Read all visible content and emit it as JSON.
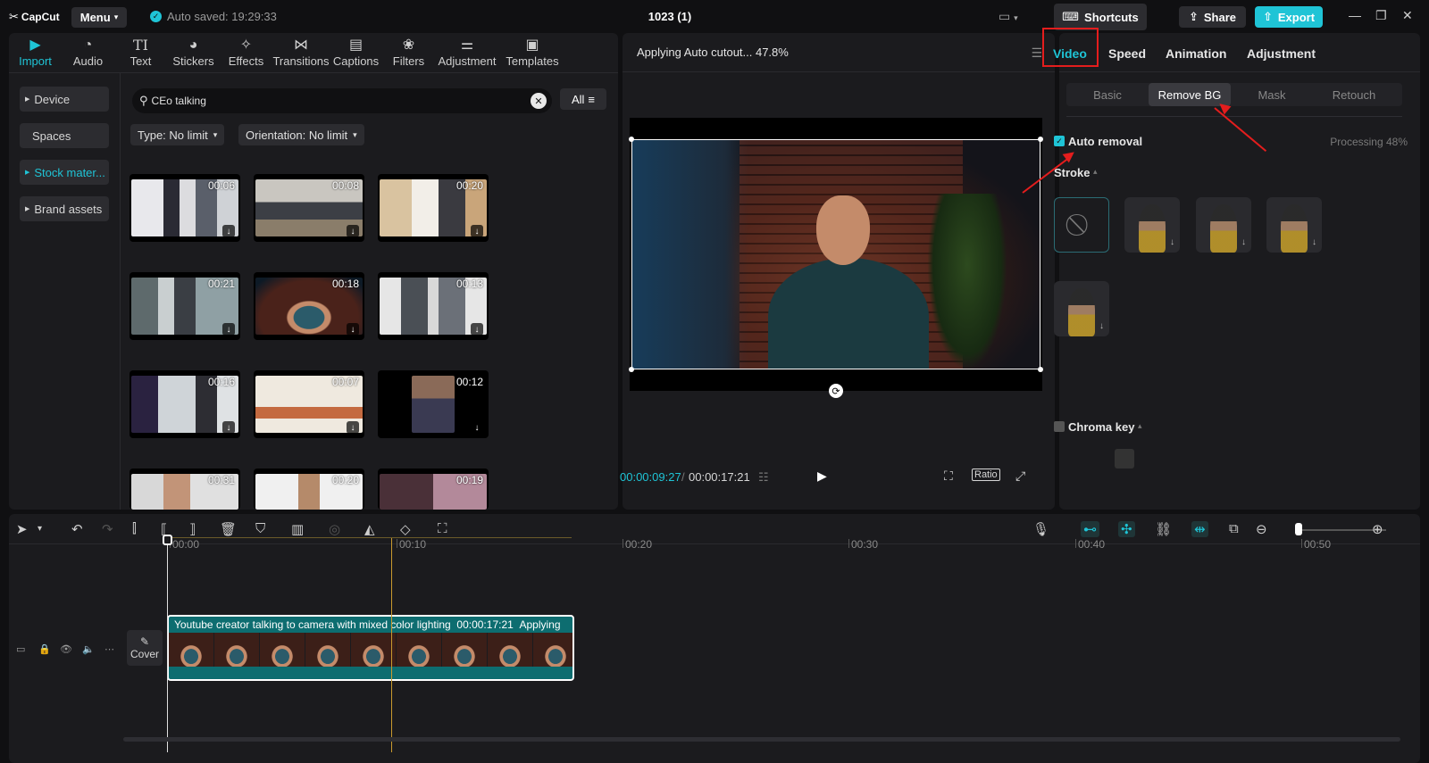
{
  "app": {
    "logo_text": "CapCut",
    "menu_label": "Menu",
    "autosave_text": "Auto saved: 19:29:33",
    "project_title": "1023 (1)",
    "shortcuts_label": "Shortcuts",
    "share_label": "Share",
    "export_label": "Export",
    "accent_color": "#1fc4d6"
  },
  "media": {
    "tabs": [
      {
        "label": "Import",
        "icon": "import-icon"
      },
      {
        "label": "Audio",
        "icon": "audio-icon"
      },
      {
        "label": "Text",
        "icon": "text-icon"
      },
      {
        "label": "Stickers",
        "icon": "stickers-icon"
      },
      {
        "label": "Effects",
        "icon": "effects-icon"
      },
      {
        "label": "Transitions",
        "icon": "transitions-icon"
      },
      {
        "label": "Captions",
        "icon": "captions-icon"
      },
      {
        "label": "Filters",
        "icon": "filters-icon"
      },
      {
        "label": "Adjustment",
        "icon": "adjustment-icon"
      },
      {
        "label": "Templates",
        "icon": "templates-icon"
      }
    ],
    "sidebar": [
      {
        "label": "Device"
      },
      {
        "label": "Spaces"
      },
      {
        "label": "Stock mater..."
      },
      {
        "label": "Brand assets"
      }
    ],
    "search_value": "CEo talking",
    "all_label": "All",
    "filters": {
      "type_label": "Type: No limit",
      "orientation_label": "Orientation: No limit"
    },
    "thumbnails": [
      {
        "duration": "00:06"
      },
      {
        "duration": "00:08"
      },
      {
        "duration": "00:20"
      },
      {
        "duration": "00:21"
      },
      {
        "duration": "00:18"
      },
      {
        "duration": "00:13"
      },
      {
        "duration": "00:16"
      },
      {
        "duration": "00:07"
      },
      {
        "duration": "00:12"
      },
      {
        "duration": "00:31"
      },
      {
        "duration": "00:20"
      },
      {
        "duration": "00:19"
      }
    ]
  },
  "player": {
    "status_text": "Applying Auto cutout... 47.8%",
    "current_time": "00:00:09:27",
    "separator": "/",
    "total_time": "00:00:17:21",
    "ratio_label": "Ratio"
  },
  "properties": {
    "tabs": [
      {
        "label": "Video"
      },
      {
        "label": "Speed"
      },
      {
        "label": "Animation"
      },
      {
        "label": "Adjustment"
      }
    ],
    "sub_tabs": [
      {
        "label": "Basic"
      },
      {
        "label": "Remove BG"
      },
      {
        "label": "Mask"
      },
      {
        "label": "Retouch"
      }
    ],
    "auto_removal_label": "Auto removal",
    "processing_text": "Processing 48%",
    "stroke_label": "Stroke",
    "chroma_key_label": "Chroma key"
  },
  "timeline": {
    "ruler": [
      "00:00",
      "00:10",
      "00:20",
      "00:30",
      "00:40",
      "00:50"
    ],
    "cover_label": "Cover",
    "clip": {
      "title": "Youtube creator talking to camera with mixed color lighting",
      "duration": "00:00:17:21",
      "status": "Applying"
    }
  }
}
